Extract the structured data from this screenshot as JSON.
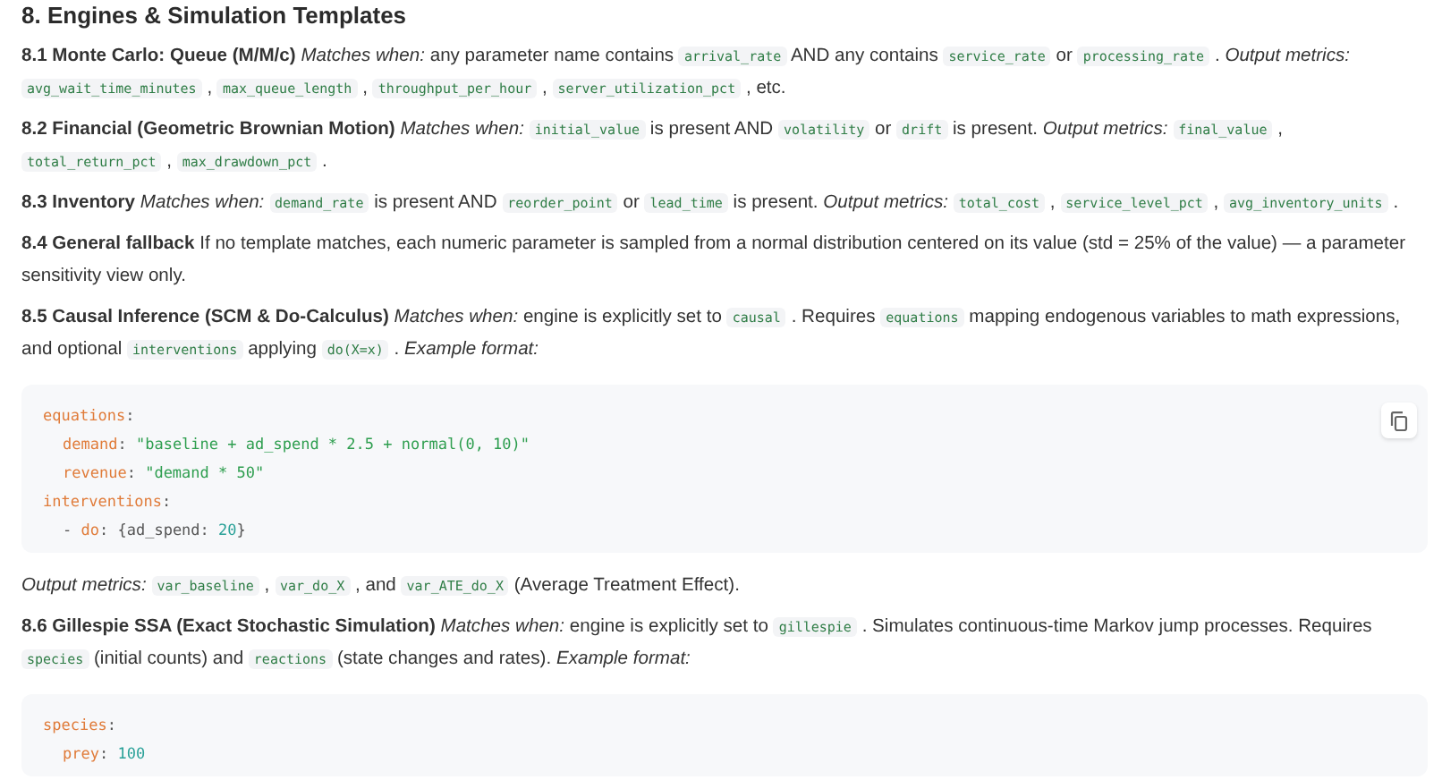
{
  "heading": "8. Engines & Simulation Templates",
  "blocks": [
    {
      "kind": "paragraph",
      "segments": [
        {
          "kind": "bold",
          "text": "8.1 Monte Carlo: Queue (M/M/c)"
        },
        {
          "kind": "italic",
          "text": "Matches when:"
        },
        {
          "kind": "text",
          "text": "any parameter name contains"
        },
        {
          "kind": "code",
          "text": "arrival_rate"
        },
        {
          "kind": "text",
          "text": "AND any contains"
        },
        {
          "kind": "code",
          "text": "service_rate"
        },
        {
          "kind": "text",
          "text": "or"
        },
        {
          "kind": "code",
          "text": "processing_rate"
        },
        {
          "kind": "text",
          "text": "."
        },
        {
          "kind": "italic",
          "text": "Output metrics:"
        },
        {
          "kind": "code",
          "text": "avg_wait_time_minutes"
        },
        {
          "kind": "text",
          "text": ","
        },
        {
          "kind": "code",
          "text": "max_queue_length"
        },
        {
          "kind": "text",
          "text": ","
        },
        {
          "kind": "code",
          "text": "throughput_per_hour"
        },
        {
          "kind": "text",
          "text": ","
        },
        {
          "kind": "code",
          "text": "server_utilization_pct"
        },
        {
          "kind": "text",
          "text": ", etc."
        }
      ]
    },
    {
      "kind": "paragraph",
      "segments": [
        {
          "kind": "bold",
          "text": "8.2 Financial (Geometric Brownian Motion)"
        },
        {
          "kind": "italic",
          "text": "Matches when:"
        },
        {
          "kind": "code",
          "text": "initial_value"
        },
        {
          "kind": "text",
          "text": "is present AND"
        },
        {
          "kind": "code",
          "text": "volatility"
        },
        {
          "kind": "text",
          "text": "or"
        },
        {
          "kind": "code",
          "text": "drift"
        },
        {
          "kind": "text",
          "text": "is present."
        },
        {
          "kind": "italic",
          "text": "Output metrics:"
        },
        {
          "kind": "code",
          "text": "final_value"
        },
        {
          "kind": "text",
          "text": ","
        },
        {
          "kind": "code",
          "text": "total_return_pct"
        },
        {
          "kind": "text",
          "text": ","
        },
        {
          "kind": "code",
          "text": "max_drawdown_pct"
        },
        {
          "kind": "text",
          "text": "."
        }
      ]
    },
    {
      "kind": "paragraph",
      "segments": [
        {
          "kind": "bold",
          "text": "8.3 Inventory"
        },
        {
          "kind": "italic",
          "text": "Matches when:"
        },
        {
          "kind": "code",
          "text": "demand_rate"
        },
        {
          "kind": "text",
          "text": "is present AND"
        },
        {
          "kind": "code",
          "text": "reorder_point"
        },
        {
          "kind": "text",
          "text": "or"
        },
        {
          "kind": "code",
          "text": "lead_time"
        },
        {
          "kind": "text",
          "text": "is present."
        },
        {
          "kind": "italic",
          "text": "Output metrics:"
        },
        {
          "kind": "code",
          "text": "total_cost"
        },
        {
          "kind": "text",
          "text": ","
        },
        {
          "kind": "code",
          "text": "service_level_pct"
        },
        {
          "kind": "text",
          "text": ","
        },
        {
          "kind": "code",
          "text": "avg_inventory_units"
        },
        {
          "kind": "text",
          "text": "."
        }
      ]
    },
    {
      "kind": "paragraph",
      "segments": [
        {
          "kind": "bold",
          "text": "8.4 General fallback"
        },
        {
          "kind": "text",
          "text": "If no template matches, each numeric parameter is sampled from a normal distribution centered on its value (std = 25% of the value) — a parameter sensitivity view only."
        }
      ]
    },
    {
      "kind": "paragraph",
      "segments": [
        {
          "kind": "bold",
          "text": "8.5 Causal Inference (SCM & Do-Calculus)"
        },
        {
          "kind": "italic",
          "text": "Matches when:"
        },
        {
          "kind": "text",
          "text": "engine is explicitly set to"
        },
        {
          "kind": "code",
          "text": "causal"
        },
        {
          "kind": "text",
          "text": ". Requires"
        },
        {
          "kind": "code",
          "text": "equations"
        },
        {
          "kind": "text",
          "text": "mapping endogenous variables to math expressions, and optional"
        },
        {
          "kind": "code",
          "text": "interventions"
        },
        {
          "kind": "text",
          "text": "applying"
        },
        {
          "kind": "code",
          "text": "do(X=x)"
        },
        {
          "kind": "text",
          "text": "."
        },
        {
          "kind": "italic",
          "text": "Example format:"
        }
      ]
    },
    {
      "kind": "code",
      "copy_button": true,
      "lines": [
        {
          "indented": false,
          "tokens": [
            {
              "kind": "key",
              "text": "equations"
            },
            {
              "kind": "punct",
              "text": ":"
            }
          ]
        },
        {
          "indented": true,
          "tokens": [
            {
              "kind": "key",
              "text": "demand"
            },
            {
              "kind": "punct",
              "text": ":"
            },
            {
              "kind": "string",
              "text": "\"baseline + ad_spend * 2.5 + normal(0, 10)\""
            }
          ]
        },
        {
          "indented": true,
          "tokens": [
            {
              "kind": "key",
              "text": "revenue"
            },
            {
              "kind": "punct",
              "text": ":"
            },
            {
              "kind": "string",
              "text": "\"demand * 50\""
            }
          ]
        },
        {
          "indented": false,
          "tokens": [
            {
              "kind": "key",
              "text": "interventions"
            },
            {
              "kind": "punct",
              "text": ":"
            }
          ]
        },
        {
          "indented": true,
          "tokens": [
            {
              "kind": "punct",
              "text": "-"
            },
            {
              "kind": "key",
              "text": "do"
            },
            {
              "kind": "punct",
              "text": ": {ad_spend:"
            },
            {
              "kind": "number",
              "text": "20"
            },
            {
              "kind": "punct",
              "text": "}"
            }
          ]
        }
      ]
    },
    {
      "kind": "paragraph",
      "segments": [
        {
          "kind": "italic",
          "text": "Output metrics:"
        },
        {
          "kind": "code",
          "text": "var_baseline"
        },
        {
          "kind": "text",
          "text": ","
        },
        {
          "kind": "code",
          "text": "var_do_X"
        },
        {
          "kind": "text",
          "text": ", and"
        },
        {
          "kind": "code",
          "text": "var_ATE_do_X"
        },
        {
          "kind": "text",
          "text": "(Average Treatment Effect)."
        }
      ]
    },
    {
      "kind": "paragraph",
      "segments": [
        {
          "kind": "bold",
          "text": "8.6 Gillespie SSA (Exact Stochastic Simulation)"
        },
        {
          "kind": "italic",
          "text": "Matches when:"
        },
        {
          "kind": "text",
          "text": "engine is explicitly set to"
        },
        {
          "kind": "code",
          "text": "gillespie"
        },
        {
          "kind": "text",
          "text": ". Simulates continuous-time Markov jump processes. Requires"
        },
        {
          "kind": "code",
          "text": "species"
        },
        {
          "kind": "text",
          "text": "(initial counts) and"
        },
        {
          "kind": "code",
          "text": "reactions"
        },
        {
          "kind": "text",
          "text": "(state changes and rates)."
        },
        {
          "kind": "italic",
          "text": "Example format:"
        }
      ]
    },
    {
      "kind": "code",
      "lines": [
        {
          "indented": false,
          "tokens": [
            {
              "kind": "key",
              "text": "species"
            },
            {
              "kind": "punct",
              "text": ":"
            }
          ]
        },
        {
          "indented": true,
          "tokens": [
            {
              "kind": "key",
              "text": "prey"
            },
            {
              "kind": "punct",
              "text": ":"
            },
            {
              "kind": "number",
              "text": "100"
            }
          ]
        }
      ]
    }
  ]
}
